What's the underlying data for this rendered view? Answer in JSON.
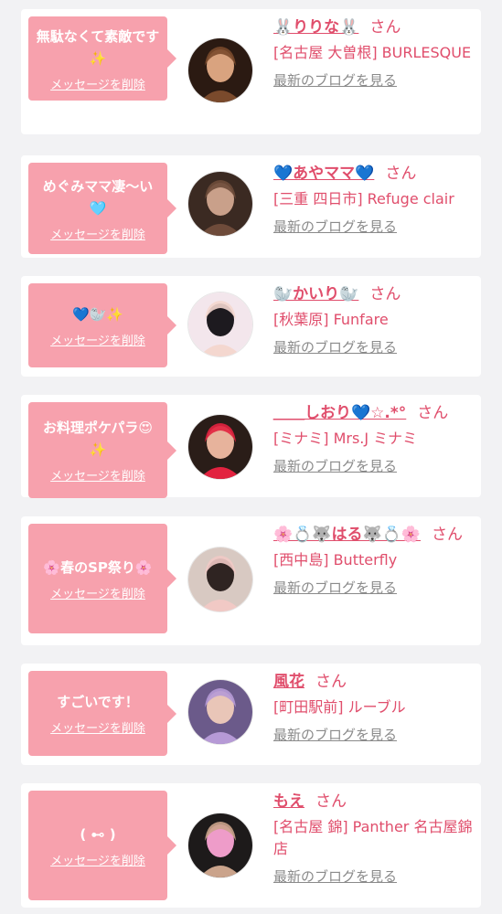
{
  "cards": [
    {
      "message": "無駄なくて素敵です✨",
      "delete_label": "メッセージを削除",
      "name": "🐰りりな🐰",
      "suffix": "さん",
      "shop": "[名古屋 大曽根] BURLESQUE",
      "blog_label": "最新のブログを見る",
      "avatar_colors": [
        "#2b1a12",
        "#d9a37f",
        "#7a4a2c"
      ]
    },
    {
      "message": "めぐみママ凄〜い🩵",
      "delete_label": "メッセージを削除",
      "name": "💙あやママ💙",
      "suffix": "さん",
      "shop": "[三重 四日市] Refuge clair",
      "blog_label": "最新のブログを見る",
      "avatar_colors": [
        "#3b2a22",
        "#c9a08a",
        "#6e4b3a"
      ]
    },
    {
      "message": "💙🦭✨",
      "delete_label": "メッセージを削除",
      "name": "🦭かいり🦭",
      "suffix": "さん",
      "shop": "[秋葉原] Funfare",
      "blog_label": "最新のブログを見る",
      "avatar_colors": [
        "#f3e6ec",
        "#1d1a1f",
        "#f4d7cf"
      ]
    },
    {
      "message": "お料理ポケパラ😍✨",
      "delete_label": "メッセージを削除",
      "name": "＿＿しおり💙☆.*°",
      "suffix": "さん",
      "shop": "[ミナミ] Mrs.J ミナミ",
      "blog_label": "最新のブログを見る",
      "avatar_colors": [
        "#2a1d18",
        "#e7b39c",
        "#e2223f"
      ]
    },
    {
      "message": "🌸春のSP祭り🌸",
      "delete_label": "メッセージを削除",
      "name": "🌸💍🐺はる🐺💍🌸",
      "suffix": "さん",
      "shop": "[西中島] Butterfly",
      "blog_label": "最新のブログを見る",
      "avatar_colors": [
        "#d8c9c2",
        "#2f2422",
        "#f1c9c5"
      ]
    },
    {
      "message": "すごいです！",
      "delete_label": "メッセージを削除",
      "name": "風花",
      "suffix": "さん",
      "shop": "[町田駅前] ルーブル",
      "blog_label": "最新のブログを見る",
      "avatar_colors": [
        "#6b5a8a",
        "#e9c6b8",
        "#b69ad6"
      ]
    },
    {
      "message": "( ⊷ )",
      "delete_label": "メッセージを削除",
      "name": "もえ",
      "suffix": "さん",
      "shop": "[名古屋 錦] Panther 名古屋錦店",
      "blog_label": "最新のブログを見る",
      "avatar_colors": [
        "#1d1a1a",
        "#ee9cc9",
        "#caa38b"
      ]
    }
  ]
}
